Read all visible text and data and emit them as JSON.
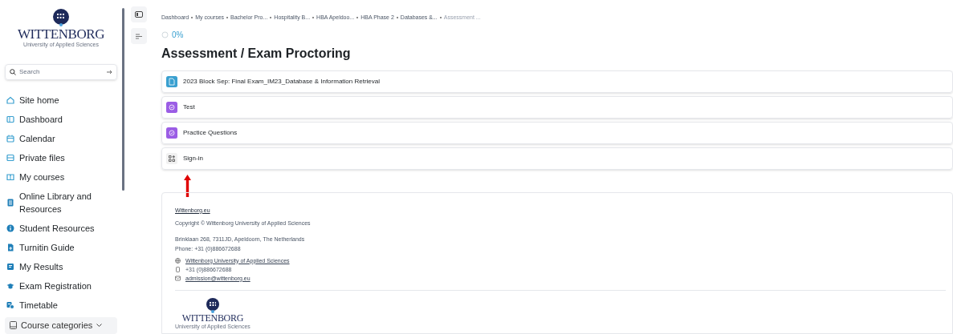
{
  "sidebar": {
    "logo": {
      "name": "WITTENBORG",
      "tagline": "University of Applied Sciences"
    },
    "search": {
      "placeholder": "Search"
    },
    "items": [
      {
        "label": "Site home",
        "kind": "home"
      },
      {
        "label": "Dashboard",
        "kind": "dashboard"
      },
      {
        "label": "Calendar",
        "kind": "calendar"
      },
      {
        "label": "Private files",
        "kind": "files"
      },
      {
        "label": "My courses",
        "kind": "book"
      },
      {
        "label": "Online Library and Resources",
        "kind": "library"
      },
      {
        "label": "Student Resources",
        "kind": "info"
      },
      {
        "label": "Turnitin Guide",
        "kind": "doc"
      },
      {
        "label": "My Results",
        "kind": "results"
      },
      {
        "label": "Exam Registration",
        "kind": "cap"
      },
      {
        "label": "Timetable",
        "kind": "timetable"
      }
    ],
    "categories_button": "Course categories"
  },
  "breadcrumb": [
    {
      "label": "Dashboard",
      "current": false
    },
    {
      "label": "My courses",
      "current": false
    },
    {
      "label": "Bachelor Pro...",
      "current": false
    },
    {
      "label": "Hospitality B...",
      "current": false
    },
    {
      "label": "HBA Apeldoo...",
      "current": false
    },
    {
      "label": "HBA Phase 2",
      "current": false
    },
    {
      "label": "Databases &...",
      "current": false
    },
    {
      "label": "Assessment ...",
      "current": true
    }
  ],
  "progress": {
    "label": "0%",
    "level": 0
  },
  "title": "Assessment / Exam Proctoring",
  "activities": [
    {
      "label": "2023 Block Sep: Final Exam_IM23_Database & Information Retrieval",
      "kind": "file"
    },
    {
      "label": "Test",
      "kind": "quiz"
    },
    {
      "label": "Practice Questions",
      "kind": "quiz"
    },
    {
      "label": "Sign-in",
      "kind": "attendance"
    }
  ],
  "footer": {
    "site_link": "Wittenborg.eu",
    "copyright": "Copyright © Wittenborg University of Applied Sciences",
    "address": "Brinklaan 268, 7311JD, Apeldoorn, The Netherlands",
    "phone": "Phone: +31 (0)886672688",
    "contacts": [
      {
        "kind": "web",
        "text": "Wittenborg University of Applied Sciences",
        "link": true
      },
      {
        "kind": "phone",
        "text": "+31 (0)886672688",
        "link": false
      },
      {
        "kind": "mail",
        "text": "admission@wittenborg.eu",
        "link": true
      }
    ],
    "logo": {
      "name": "WITTENBORG",
      "tagline": "University of Applied Sciences"
    }
  }
}
